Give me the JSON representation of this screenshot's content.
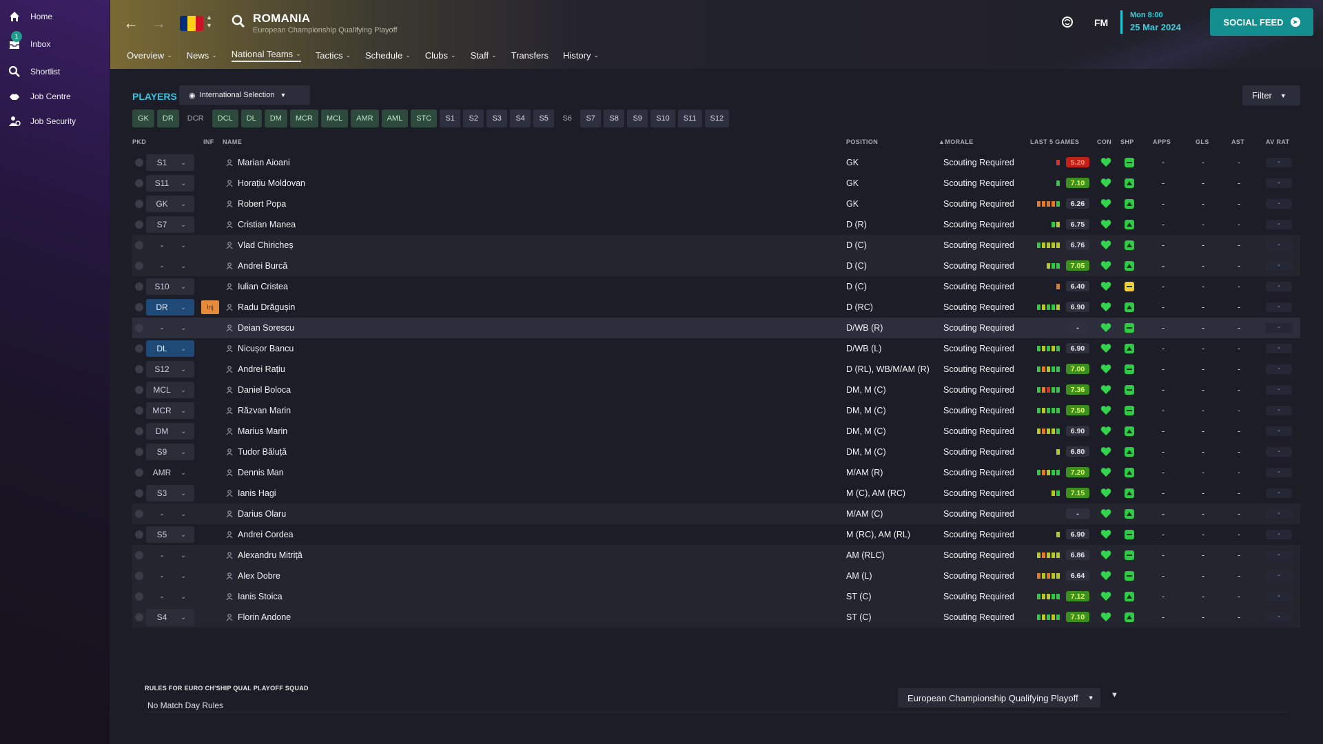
{
  "sidebar": {
    "items": [
      {
        "label": "Home",
        "icon": "home-icon"
      },
      {
        "label": "Inbox",
        "icon": "inbox-icon",
        "badge": "1"
      },
      {
        "label": "Shortlist",
        "icon": "search-icon"
      },
      {
        "label": "Job Centre",
        "icon": "job-centre-icon"
      },
      {
        "label": "Job Security",
        "icon": "job-security-icon"
      }
    ]
  },
  "header": {
    "team_name": "ROMANIA",
    "subtitle": "European Championship Qualifying Playoff",
    "flag_colors": [
      "#002B7F",
      "#FCD116",
      "#CE1126"
    ],
    "brand": "FM",
    "time": "Mon 8:00",
    "date": "25 Mar 2024",
    "social_feed": "SOCIAL FEED",
    "nav": [
      {
        "label": "Overview",
        "dropdown": true
      },
      {
        "label": "News",
        "dropdown": true
      },
      {
        "label": "National Teams",
        "dropdown": true,
        "active": true
      },
      {
        "label": "Tactics",
        "dropdown": true
      },
      {
        "label": "Schedule",
        "dropdown": true
      },
      {
        "label": "Clubs",
        "dropdown": true
      },
      {
        "label": "Staff",
        "dropdown": true
      },
      {
        "label": "Transfers",
        "dropdown": false
      },
      {
        "label": "History",
        "dropdown": true
      }
    ]
  },
  "players": {
    "title": "PLAYERS",
    "selection_dropdown": "International Selection",
    "filter": "Filter",
    "position_tabs": [
      {
        "label": "GK",
        "state": "g"
      },
      {
        "label": "DR",
        "state": "g"
      },
      {
        "label": "DCR",
        "state": "x"
      },
      {
        "label": "DCL",
        "state": "g"
      },
      {
        "label": "DL",
        "state": "g"
      },
      {
        "label": "DM",
        "state": "g"
      },
      {
        "label": "MCR",
        "state": "g"
      },
      {
        "label": "MCL",
        "state": "g"
      },
      {
        "label": "AMR",
        "state": "g"
      },
      {
        "label": "AML",
        "state": "g"
      },
      {
        "label": "STC",
        "state": "g"
      },
      {
        "label": "S1",
        "state": "n"
      },
      {
        "label": "S2",
        "state": "n"
      },
      {
        "label": "S3",
        "state": "n"
      },
      {
        "label": "S4",
        "state": "n"
      },
      {
        "label": "S5",
        "state": "n"
      },
      {
        "label": "S6",
        "state": "x"
      },
      {
        "label": "S7",
        "state": "n"
      },
      {
        "label": "S8",
        "state": "n"
      },
      {
        "label": "S9",
        "state": "n"
      },
      {
        "label": "S10",
        "state": "n"
      },
      {
        "label": "S11",
        "state": "n"
      },
      {
        "label": "S12",
        "state": "n"
      }
    ],
    "columns": {
      "pkd": "PKD",
      "inf": "INF",
      "name": "NAME",
      "position": "POSITION",
      "morale": "MORALE",
      "last5": "LAST 5 GAMES",
      "con": "CON",
      "shp": "SHP",
      "apps": "APPS",
      "gls": "GLS",
      "ast": "AST",
      "avrat": "AV RAT"
    },
    "rows": [
      {
        "pkd": "S1",
        "inf": "",
        "name": "Marian Aioani",
        "position": "GK",
        "morale": "Scouting Required",
        "form": [
          "r"
        ],
        "rating": "5.20",
        "rating_style": "red",
        "shp": "green-flat",
        "apps": "-",
        "gls": "-",
        "ast": "-",
        "avrat": "-",
        "sel_style": "fill",
        "bg": "none"
      },
      {
        "pkd": "S11",
        "inf": "",
        "name": "Horațiu Moldovan",
        "position": "GK",
        "morale": "Scouting Required",
        "form": [
          "g"
        ],
        "rating": "7.10",
        "rating_style": "green",
        "shp": "green-up",
        "apps": "-",
        "gls": "-",
        "ast": "-",
        "avrat": "-",
        "sel_style": "fill",
        "bg": "none"
      },
      {
        "pkd": "GK",
        "inf": "",
        "name": "Robert Popa",
        "position": "GK",
        "morale": "Scouting Required",
        "form": [
          "o",
          "o",
          "o",
          "o",
          "g"
        ],
        "rating": "6.26",
        "rating_style": "grey",
        "shp": "green-up",
        "apps": "-",
        "gls": "-",
        "ast": "-",
        "avrat": "-",
        "sel_style": "fill",
        "bg": "none"
      },
      {
        "pkd": "S7",
        "inf": "",
        "name": "Cristian Manea",
        "position": "D (R)",
        "morale": "Scouting Required",
        "form": [
          "g",
          "y"
        ],
        "rating": "6.75",
        "rating_style": "grey",
        "shp": "green-up",
        "apps": "-",
        "gls": "-",
        "ast": "-",
        "avrat": "-",
        "sel_style": "fill",
        "bg": "none"
      },
      {
        "pkd": "-",
        "inf": "",
        "name": "Vlad Chiricheș",
        "position": "D (C)",
        "morale": "Scouting Required",
        "form": [
          "g",
          "y",
          "y",
          "y",
          "y"
        ],
        "rating": "6.76",
        "rating_style": "grey",
        "shp": "green-up",
        "apps": "-",
        "gls": "-",
        "ast": "-",
        "avrat": "-",
        "sel_style": "none",
        "bg": "alt"
      },
      {
        "pkd": "-",
        "inf": "",
        "name": "Andrei Burcă",
        "position": "D (C)",
        "morale": "Scouting Required",
        "form": [
          "y",
          "g",
          "g"
        ],
        "rating": "7.05",
        "rating_style": "green",
        "shp": "green-up",
        "apps": "-",
        "gls": "-",
        "ast": "-",
        "avrat": "-",
        "sel_style": "none",
        "bg": "alt"
      },
      {
        "pkd": "S10",
        "inf": "",
        "name": "Iulian Cristea",
        "position": "D (C)",
        "morale": "Scouting Required",
        "form": [
          "o"
        ],
        "rating": "6.40",
        "rating_style": "grey",
        "shp": "yellow-flat",
        "apps": "-",
        "gls": "-",
        "ast": "-",
        "avrat": "-",
        "sel_style": "fill",
        "bg": "none"
      },
      {
        "pkd": "DR",
        "inf": "Inj",
        "name": "Radu Drăgușin",
        "position": "D (RC)",
        "morale": "Scouting Required",
        "form": [
          "g",
          "y",
          "g",
          "g",
          "y"
        ],
        "rating": "6.90",
        "rating_style": "grey",
        "shp": "green-up",
        "apps": "-",
        "gls": "-",
        "ast": "-",
        "avrat": "-",
        "sel_style": "blue",
        "bg": "none"
      },
      {
        "pkd": "-",
        "inf": "",
        "name": "Deian Sorescu",
        "position": "D/WB (R)",
        "morale": "Scouting Required",
        "form": [],
        "rating": "-",
        "rating_style": "grey",
        "shp": "green-flat",
        "apps": "-",
        "gls": "-",
        "ast": "-",
        "avrat": "-",
        "sel_style": "none",
        "bg": "hl"
      },
      {
        "pkd": "DL",
        "inf": "",
        "name": "Nicușor Bancu",
        "position": "D/WB (L)",
        "morale": "Scouting Required",
        "form": [
          "g",
          "y",
          "g",
          "y",
          "g"
        ],
        "rating": "6.90",
        "rating_style": "grey",
        "shp": "green-up",
        "apps": "-",
        "gls": "-",
        "ast": "-",
        "avrat": "-",
        "sel_style": "blue",
        "bg": "none"
      },
      {
        "pkd": "S12",
        "inf": "",
        "name": "Andrei Rațiu",
        "position": "D (RL), WB/M/AM (R)",
        "morale": "Scouting Required",
        "form": [
          "g",
          "o",
          "y",
          "g",
          "g"
        ],
        "rating": "7.00",
        "rating_style": "green",
        "shp": "green-flat",
        "apps": "-",
        "gls": "-",
        "ast": "-",
        "avrat": "-",
        "sel_style": "fill",
        "bg": "none"
      },
      {
        "pkd": "MCL",
        "inf": "",
        "name": "Daniel Boloca",
        "position": "DM, M (C)",
        "morale": "Scouting Required",
        "form": [
          "g",
          "o",
          "r",
          "g",
          "g"
        ],
        "rating": "7.36",
        "rating_style": "green",
        "shp": "green-flat",
        "apps": "-",
        "gls": "-",
        "ast": "-",
        "avrat": "-",
        "sel_style": "fill",
        "bg": "none"
      },
      {
        "pkd": "MCR",
        "inf": "",
        "name": "Răzvan Marin",
        "position": "DM, M (C)",
        "morale": "Scouting Required",
        "form": [
          "g",
          "y",
          "g",
          "g",
          "g"
        ],
        "rating": "7.50",
        "rating_style": "green",
        "shp": "green-flat",
        "apps": "-",
        "gls": "-",
        "ast": "-",
        "avrat": "-",
        "sel_style": "fill",
        "bg": "none"
      },
      {
        "pkd": "DM",
        "inf": "",
        "name": "Marius Marin",
        "position": "DM, M (C)",
        "morale": "Scouting Required",
        "form": [
          "y",
          "o",
          "y",
          "y",
          "g"
        ],
        "rating": "6.90",
        "rating_style": "grey",
        "shp": "green-up",
        "apps": "-",
        "gls": "-",
        "ast": "-",
        "avrat": "-",
        "sel_style": "fill",
        "bg": "none"
      },
      {
        "pkd": "S9",
        "inf": "",
        "name": "Tudor Băluță",
        "position": "DM, M (C)",
        "morale": "Scouting Required",
        "form": [
          "y"
        ],
        "rating": "6.80",
        "rating_style": "grey",
        "shp": "green-up",
        "apps": "-",
        "gls": "-",
        "ast": "-",
        "avrat": "-",
        "sel_style": "fill",
        "bg": "none"
      },
      {
        "pkd": "AMR",
        "inf": "",
        "name": "Dennis Man",
        "position": "M/AM (R)",
        "morale": "Scouting Required",
        "form": [
          "g",
          "o",
          "y",
          "g",
          "g"
        ],
        "rating": "7.20",
        "rating_style": "green",
        "shp": "green-up",
        "apps": "-",
        "gls": "-",
        "ast": "-",
        "avrat": "-",
        "sel_style": "none",
        "bg": "none"
      },
      {
        "pkd": "S3",
        "inf": "",
        "name": "Ianis Hagi",
        "position": "M (C), AM (RC)",
        "morale": "Scouting Required",
        "form": [
          "y",
          "g"
        ],
        "rating": "7.15",
        "rating_style": "green",
        "shp": "green-up",
        "apps": "-",
        "gls": "-",
        "ast": "-",
        "avrat": "-",
        "sel_style": "fill",
        "bg": "none"
      },
      {
        "pkd": "-",
        "inf": "",
        "name": "Darius Olaru",
        "position": "M/AM (C)",
        "morale": "Scouting Required",
        "form": [],
        "rating": "-",
        "rating_style": "grey",
        "shp": "green-up",
        "apps": "-",
        "gls": "-",
        "ast": "-",
        "avrat": "-",
        "sel_style": "none",
        "bg": "alt"
      },
      {
        "pkd": "S5",
        "inf": "",
        "name": "Andrei Cordea",
        "position": "M (RC), AM (RL)",
        "morale": "Scouting Required",
        "form": [
          "y"
        ],
        "rating": "6.90",
        "rating_style": "grey",
        "shp": "green-flat",
        "apps": "-",
        "gls": "-",
        "ast": "-",
        "avrat": "-",
        "sel_style": "fill",
        "bg": "none"
      },
      {
        "pkd": "-",
        "inf": "",
        "name": "Alexandru Mitriță",
        "position": "AM (RLC)",
        "morale": "Scouting Required",
        "form": [
          "y",
          "o",
          "y",
          "y",
          "y"
        ],
        "rating": "6.86",
        "rating_style": "grey",
        "shp": "green-flat",
        "apps": "-",
        "gls": "-",
        "ast": "-",
        "avrat": "-",
        "sel_style": "none",
        "bg": "alt"
      },
      {
        "pkd": "-",
        "inf": "",
        "name": "Alex Dobre",
        "position": "AM (L)",
        "morale": "Scouting Required",
        "form": [
          "o",
          "y",
          "o",
          "y",
          "y"
        ],
        "rating": "6.64",
        "rating_style": "grey",
        "shp": "green-flat",
        "apps": "-",
        "gls": "-",
        "ast": "-",
        "avrat": "-",
        "sel_style": "none",
        "bg": "alt"
      },
      {
        "pkd": "-",
        "inf": "",
        "name": "Ianis Stoica",
        "position": "ST (C)",
        "morale": "Scouting Required",
        "form": [
          "g",
          "y",
          "y",
          "g",
          "g"
        ],
        "rating": "7.12",
        "rating_style": "green",
        "shp": "green-up",
        "apps": "-",
        "gls": "-",
        "ast": "-",
        "avrat": "-",
        "sel_style": "none",
        "bg": "alt"
      },
      {
        "pkd": "S4",
        "inf": "",
        "name": "Florin Andone",
        "position": "ST (C)",
        "morale": "Scouting Required",
        "form": [
          "g",
          "y",
          "g",
          "y",
          "g"
        ],
        "rating": "7.10",
        "rating_style": "green",
        "shp": "green-up",
        "apps": "-",
        "gls": "-",
        "ast": "-",
        "avrat": "-",
        "sel_style": "fill",
        "bg": "alt"
      }
    ]
  },
  "rules": {
    "title": "RULES FOR EURO CH'SHIP QUAL PLAYOFF SQUAD",
    "text": "No Match Day Rules",
    "competition": "European Championship Qualifying Playoff"
  },
  "colors": {
    "accent_cyan": "#3cc4e0",
    "social_teal": "#128e8e",
    "form_green": "#33c748",
    "form_yellow": "#b7c926",
    "form_orange": "#e07a2f",
    "form_red": "#d8322a"
  }
}
